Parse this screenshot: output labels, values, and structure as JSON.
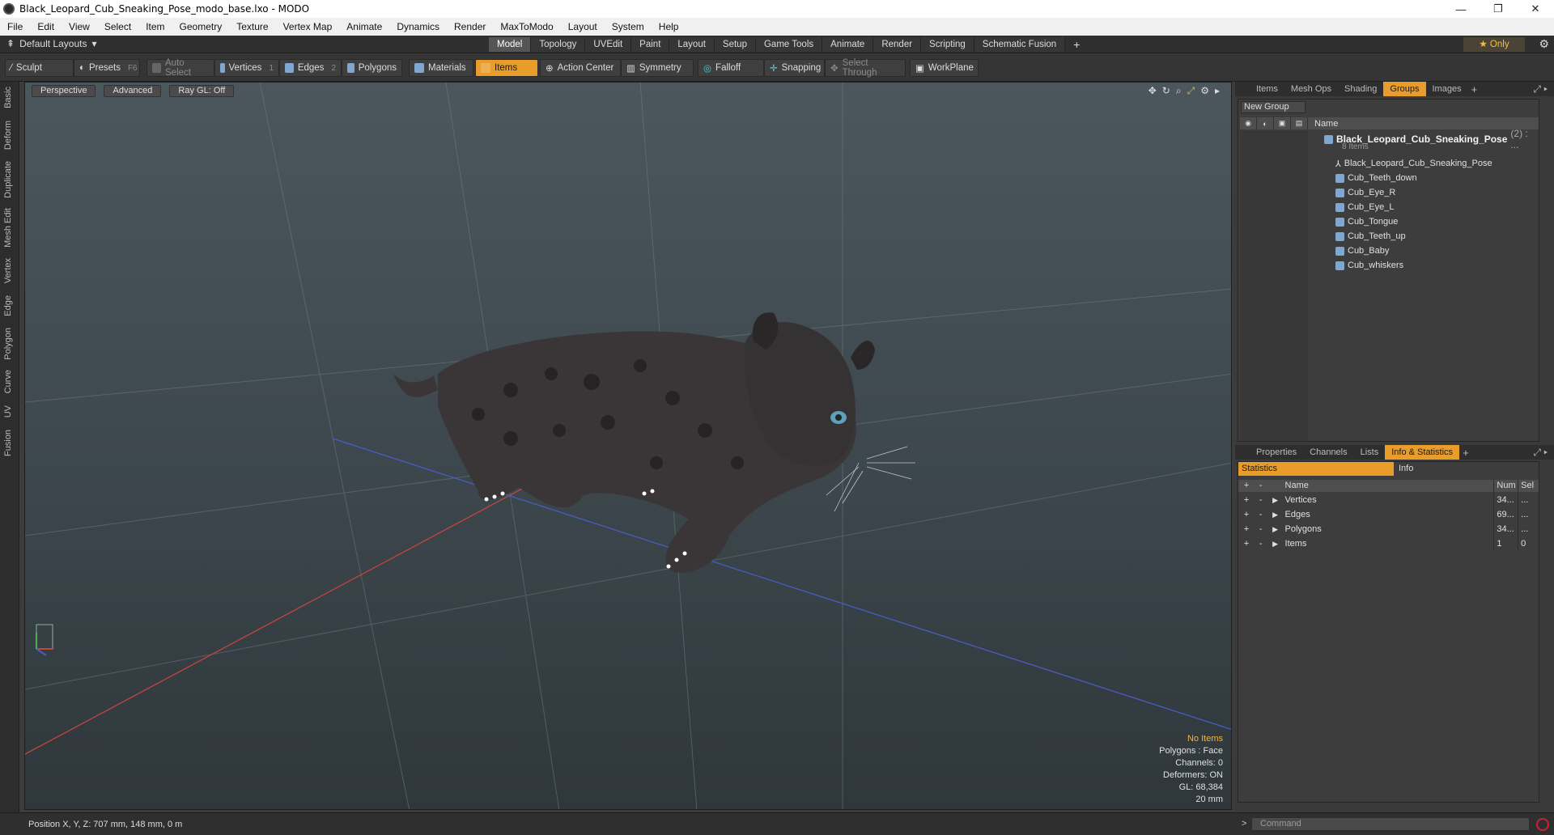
{
  "window": {
    "title": "Black_Leopard_Cub_Sneaking_Pose_modo_base.lxo - MODO",
    "controls": [
      "—",
      "❐",
      "✕"
    ]
  },
  "menu": [
    "File",
    "Edit",
    "View",
    "Select",
    "Item",
    "Geometry",
    "Texture",
    "Vertex Map",
    "Animate",
    "Dynamics",
    "Render",
    "MaxToModo",
    "Layout",
    "System",
    "Help"
  ],
  "layout": {
    "label": "Default Layouts",
    "tabs": [
      "Model",
      "Topology",
      "UVEdit",
      "Paint",
      "Layout",
      "Setup",
      "Game Tools",
      "Animate",
      "Render",
      "Scripting",
      "Schematic Fusion"
    ],
    "active_tab": "Model",
    "only_label": "Only"
  },
  "toolbar": {
    "sculpt": "Sculpt",
    "presets": "Presets",
    "presets_key": "F6",
    "auto_select": "Auto Select",
    "vertices": "Vertices",
    "vertices_key": "1",
    "edges": "Edges",
    "edges_key": "2",
    "polygons": "Polygons",
    "materials": "Materials",
    "items": "Items",
    "action_center": "Action Center",
    "symmetry": "Symmetry",
    "falloff": "Falloff",
    "snapping": "Snapping",
    "select_through": "Select Through",
    "workplane": "WorkPlane"
  },
  "left_tabs": [
    "Basic",
    "Deform",
    "Duplicate",
    "Mesh Edit",
    "Vertex",
    "Edge",
    "Polygon",
    "Curve",
    "UV",
    "Fusion"
  ],
  "viewport": {
    "perspective": "Perspective",
    "advanced": "Advanced",
    "raygl": "Ray GL: Off",
    "info": {
      "no_items": "No Items",
      "polygons": "Polygons : Face",
      "channels": "Channels: 0",
      "deformers": "Deformers: ON",
      "gl": "GL: 68,384",
      "scale": "20 mm"
    }
  },
  "groups_panel": {
    "tabs": [
      "Items",
      "Mesh Ops",
      "Shading",
      "Groups",
      "Images"
    ],
    "active_tab": "Groups",
    "new_group": "New Group",
    "name_header": "Name",
    "group_name": "Black_Leopard_Cub_Sneaking_Pose",
    "group_count": "(2) : ...",
    "group_sub": "8 Items",
    "children": [
      "Black_Leopard_Cub_Sneaking_Pose",
      "Cub_Teeth_down",
      "Cub_Eye_R",
      "Cub_Eye_L",
      "Cub_Tongue",
      "Cub_Teeth_up",
      "Cub_Baby",
      "Cub_whiskers"
    ]
  },
  "stats_panel": {
    "tabs": [
      "Properties",
      "Channels",
      "Lists",
      "Info & Statistics"
    ],
    "active_tab": "Info & Statistics",
    "statistics": "Statistics",
    "info": "Info",
    "headers": {
      "name": "Name",
      "num": "Num",
      "sel": "Sel"
    },
    "rows": [
      {
        "name": "Vertices",
        "num": "34...",
        "sel": "..."
      },
      {
        "name": "Edges",
        "num": "69...",
        "sel": "..."
      },
      {
        "name": "Polygons",
        "num": "34...",
        "sel": "..."
      },
      {
        "name": "Items",
        "num": "1",
        "sel": "0"
      }
    ]
  },
  "status": {
    "position": "Position X, Y, Z:  707 mm, 148 mm, 0 m",
    "command_placeholder": "Command"
  }
}
